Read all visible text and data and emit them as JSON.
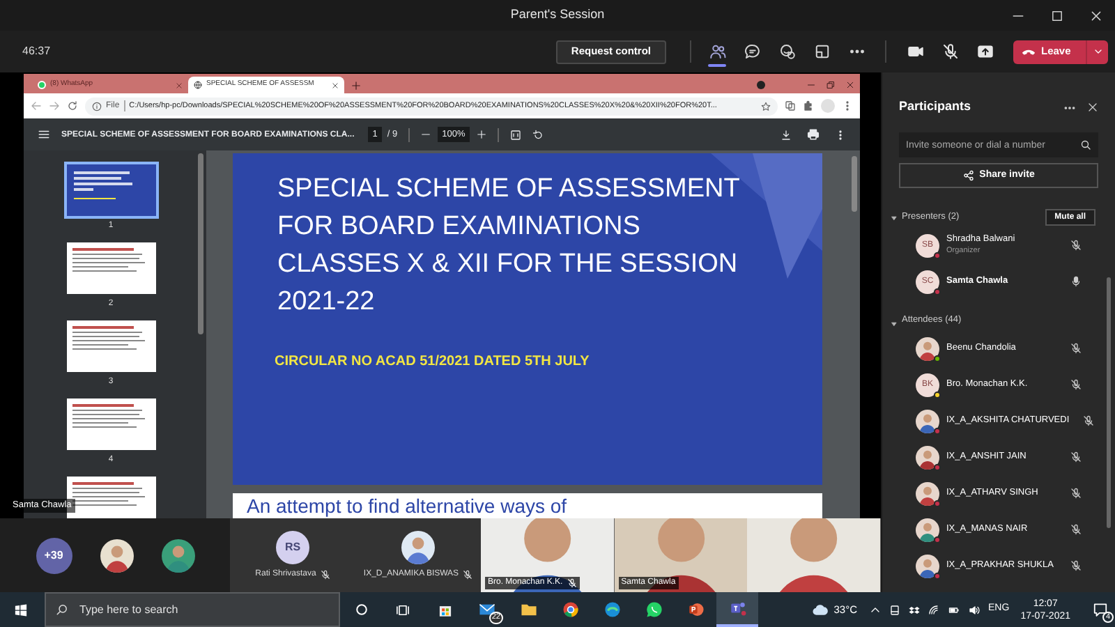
{
  "window": {
    "title": "Parent's Session"
  },
  "meeting_bar": {
    "timer": "46:37",
    "request_control": "Request control",
    "tools": [
      {
        "kind": "people",
        "selected": true
      },
      {
        "kind": "chat",
        "selected": false
      },
      {
        "kind": "reactions",
        "selected": false
      },
      {
        "kind": "rooms",
        "selected": false
      },
      {
        "kind": "more",
        "selected": false
      }
    ],
    "devices": [
      {
        "kind": "camera"
      },
      {
        "kind": "mic-off"
      },
      {
        "kind": "share"
      }
    ],
    "leave": "Leave"
  },
  "browser": {
    "tabs": [
      {
        "label": "(8) WhatsApp",
        "selected": false
      },
      {
        "label": "SPECIAL SCHEME OF ASSESSM",
        "selected": true
      }
    ],
    "address": {
      "scheme": "File",
      "url": "C:/Users/hp-pc/Downloads/SPECIAL%20SCHEME%20OF%20ASSESSMENT%20FOR%20BOARD%20EXAMINATIONS%20CLASSES%20X%20&%20XII%20FOR%20T..."
    },
    "pdf_toolbar": {
      "title": "SPECIAL SCHEME OF ASSESSMENT FOR BOARD EXAMINATIONS CLA...",
      "page": "1",
      "page_count": "/ 9",
      "zoom": "100%"
    },
    "thumbnails": [
      {
        "number": "1",
        "selected": true,
        "kind": "slide"
      },
      {
        "number": "2",
        "selected": false,
        "kind": "page"
      },
      {
        "number": "3",
        "selected": false,
        "kind": "page"
      },
      {
        "number": "4",
        "selected": false,
        "kind": "page"
      },
      {
        "selected": false,
        "kind": "page"
      }
    ],
    "slide": {
      "title_lines": [
        "SPECIAL SCHEME OF ASSESSMENT",
        "FOR BOARD EXAMINATIONS",
        "CLASSES X & XII FOR THE SESSION",
        "2021-22"
      ],
      "circular": "CIRCULAR NO ACAD 51/2021 DATED 5TH JULY"
    },
    "next_page_text": "An attempt to find alternative ways of"
  },
  "shared_by": "Samta Chawla",
  "participants": {
    "title": "Participants",
    "search": {
      "placeholder": "Invite someone or dial a number"
    },
    "share_invite": "Share invite",
    "sections": [
      {
        "title": "Presenters (2)",
        "expanded": true,
        "action": "Mute all",
        "people": [
          {
            "name": "Shradha Balwani",
            "subtitle": "Organizer",
            "initials": "SB",
            "color": "#c4314b",
            "muted": true
          },
          {
            "name": "Samta Chawla",
            "initials": "SC",
            "color": "#c4314b",
            "muted": false
          }
        ]
      },
      {
        "title": "Attendees (44)",
        "expanded": true,
        "people": [
          {
            "name": "Beenu Chandolia",
            "color": "#6bb700",
            "muted": true
          },
          {
            "name": "Bro. Monachan K.K.",
            "initials": "BK",
            "color": "#f8d22a",
            "muted": true
          },
          {
            "name": "IX_A_AKSHITA CHATURVEDI",
            "color": "#c4314b",
            "muted": true
          },
          {
            "name": "IX_A_ANSHIT JAIN",
            "color": "#c4314b",
            "muted": true
          },
          {
            "name": "IX_A_ATHARV SINGH",
            "color": "#c4314b",
            "muted": true
          },
          {
            "name": "IX_A_MANAS NAIR",
            "color": "#c4314b",
            "muted": true
          },
          {
            "name": "IX_A_PRAKHAR SHUKLA",
            "color": "#c4314b",
            "muted": true
          }
        ]
      }
    ]
  },
  "video_strip": {
    "overflow": "+39",
    "tiles": [
      {
        "kind": "avatar",
        "name": "Rati Shrivastava",
        "initials": "RS",
        "muted": true
      },
      {
        "kind": "avatar",
        "name": "IX_D_ANAMIKA BISWAS",
        "muted": true
      },
      {
        "kind": "video",
        "name": "Bro. Monachan K.K.",
        "muted": true
      },
      {
        "kind": "video",
        "name": "Samta Chawla",
        "muted": false
      },
      {
        "kind": "video"
      }
    ]
  },
  "taskbar": {
    "search": {
      "placeholder": "Type here to search"
    },
    "apps": [
      {
        "kind": "store",
        "selected": false
      },
      {
        "kind": "mail",
        "badge": "22",
        "selected": false
      },
      {
        "kind": "folder",
        "selected": false
      },
      {
        "kind": "chrome",
        "selected": false
      },
      {
        "kind": "edge",
        "selected": false
      },
      {
        "kind": "whatsapp",
        "selected": false
      },
      {
        "kind": "powerpoint",
        "selected": false
      },
      {
        "kind": "teams",
        "selected": true
      }
    ],
    "weather": "33°C",
    "language": "ENG",
    "time": "12:07",
    "date": "17-07-2021",
    "notifications": "4"
  }
}
